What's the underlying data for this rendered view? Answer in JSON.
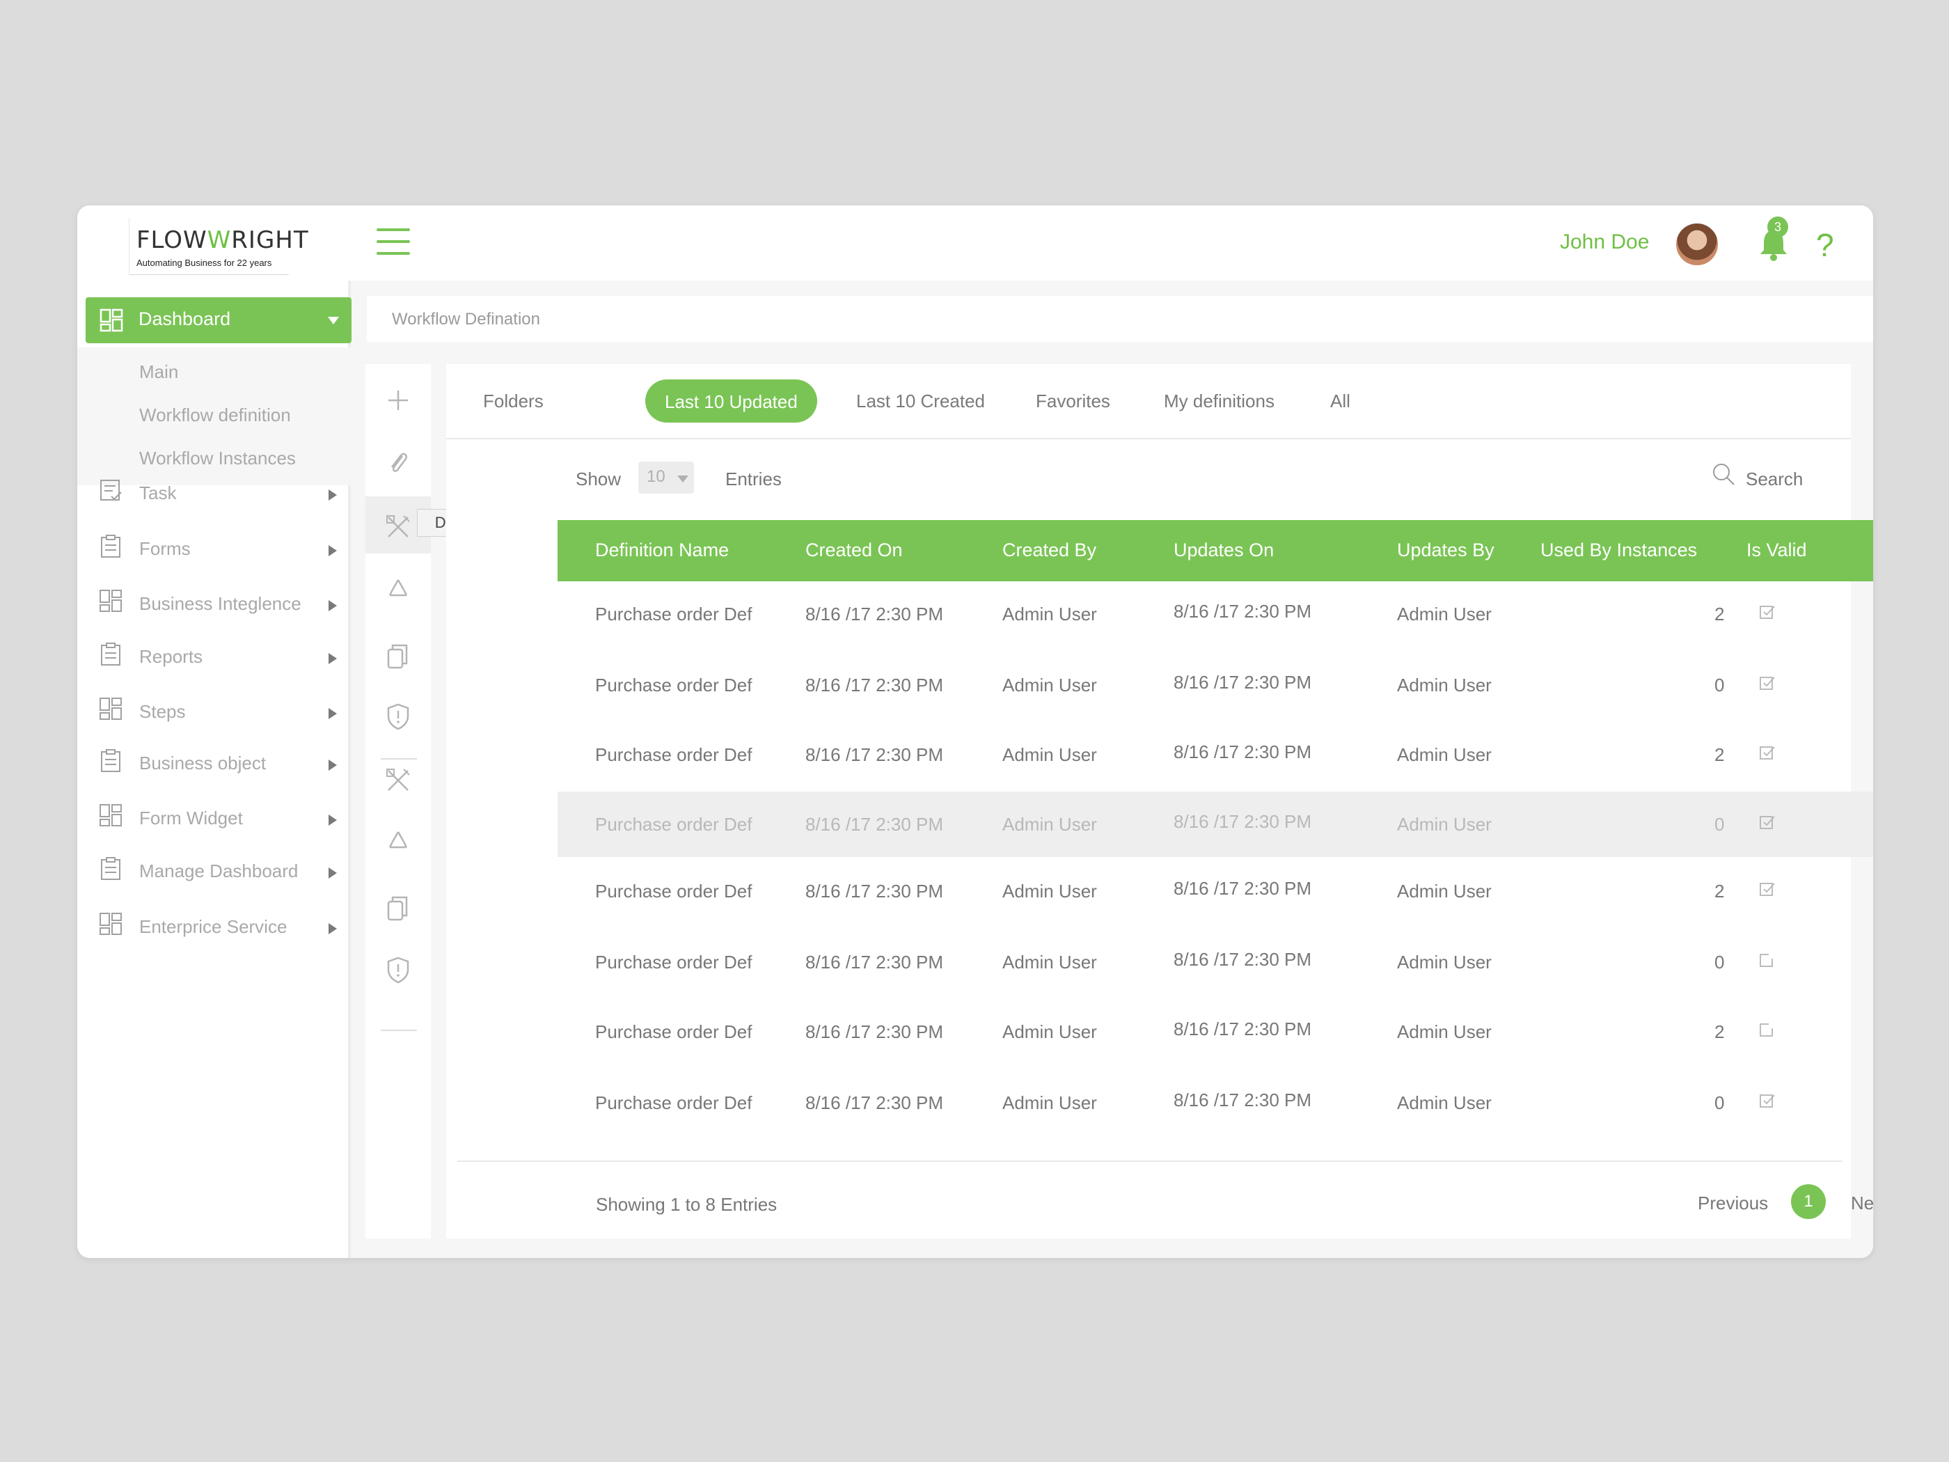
{
  "colors": {
    "accent": "#7ac455",
    "background": "#dcdcdc",
    "row_highlight": "#eeeeee"
  },
  "header": {
    "logo": {
      "part1": "FLOW",
      "part2": "RIGHT",
      "w": "W",
      "tagline": "Automating Business for 22 years"
    },
    "user_name": "John Doe",
    "notification_count": "3",
    "help": "?"
  },
  "sidebar": {
    "dashboard_label": "Dashboard",
    "sub_items": [
      "Main",
      "Workflow definition",
      "Workflow Instances"
    ],
    "items": [
      {
        "label": "Task",
        "icon": "task-icon"
      },
      {
        "label": "Forms",
        "icon": "clipboard-icon"
      },
      {
        "label": "Business Integlence",
        "icon": "grid-icon"
      },
      {
        "label": "Reports",
        "icon": "clipboard-icon"
      },
      {
        "label": "Steps",
        "icon": "grid-icon"
      },
      {
        "label": "Business object",
        "icon": "clipboard-icon"
      },
      {
        "label": "Form Widget",
        "icon": "grid-icon"
      },
      {
        "label": "Manage Dashboard",
        "icon": "clipboard-icon"
      },
      {
        "label": "Enterprice Service",
        "icon": "grid-icon"
      }
    ]
  },
  "breadcrumb": "Workflow Defination",
  "toolstrip": {
    "tooltip": "Design",
    "tools": [
      "plus-icon",
      "paperclip-icon",
      "design-icon",
      "recycle-icon",
      "copy-icon",
      "shield-icon",
      "design-icon",
      "recycle-icon",
      "copy-icon",
      "shield-icon"
    ]
  },
  "tabs": [
    "Folders",
    "Last 10 Updated",
    "Last 10 Created",
    "Favorites",
    "My definitions",
    "All"
  ],
  "active_tab": "Last 10 Updated",
  "controls": {
    "show_label": "Show",
    "show_value": "10",
    "entries_label": "Entries",
    "search_label": "Search"
  },
  "table": {
    "columns": [
      "Definition Name",
      "Created On",
      "Created By",
      "Updates On",
      "Updates By",
      "Used By Instances",
      "Is Valid"
    ],
    "rows": [
      [
        "Purchase order Def",
        "8/16 /17  2:30 PM",
        "Admin User",
        "8/16 /17  2:30 PM",
        "Admin User",
        "2",
        true
      ],
      [
        "Purchase order Def",
        "8/16 /17  2:30 PM",
        "Admin User",
        "8/16 /17  2:30 PM",
        "Admin User",
        "0",
        true
      ],
      [
        "Purchase order Def",
        "8/16 /17  2:30 PM",
        "Admin User",
        "8/16 /17  2:30 PM",
        "Admin User",
        "2",
        true
      ],
      [
        "Purchase order Def",
        "8/16 /17  2:30 PM",
        "Admin User",
        "8/16 /17  2:30 PM",
        "Admin User",
        "0",
        true
      ],
      [
        "Purchase order Def",
        "8/16 /17  2:30 PM",
        "Admin User",
        "8/16 /17  2:30 PM",
        "Admin User",
        "2",
        true
      ],
      [
        "Purchase order Def",
        "8/16 /17  2:30 PM",
        "Admin User",
        "8/16 /17  2:30 PM",
        "Admin User",
        "0",
        false
      ],
      [
        "Purchase order Def",
        "8/16 /17  2:30 PM",
        "Admin User",
        "8/16 /17  2:30 PM",
        "Admin User",
        "2",
        false
      ],
      [
        "Purchase order Def",
        "8/16 /17  2:30 PM",
        "Admin User",
        "8/16 /17  2:30 PM",
        "Admin User",
        "0",
        true
      ]
    ],
    "highlighted_row": 3
  },
  "footer": {
    "showing": "Showing 1 to 8 Entries",
    "previous": "Previous",
    "page": "1",
    "next": "Next"
  }
}
